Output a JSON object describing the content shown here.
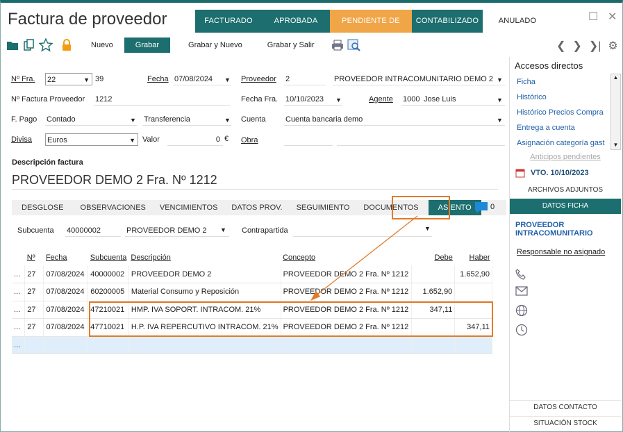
{
  "window": {
    "title": "Factura de proveedor"
  },
  "status_steps": [
    {
      "label": "FACTURADO",
      "width": 96
    },
    {
      "label": "APROBADA",
      "width": 98
    },
    {
      "label": "PENDIENTE DE PAGO",
      "width": 118
    },
    {
      "label": "CONTABILIZADO",
      "width": 102
    },
    {
      "label": "ANULADO",
      "width": 100
    }
  ],
  "toolbar": {
    "nuevo": "Nuevo",
    "grabar": "Grabar",
    "grabar_nuevo": "Grabar y Nuevo",
    "grabar_salir": "Grabar y Salir"
  },
  "form": {
    "nfra_label": "Nº Fra.",
    "nfra_serie": "22",
    "nfra_num": "39",
    "fecha_label": "Fecha",
    "fecha": "07/08/2024",
    "proveedor_label": "Proveedor",
    "proveedor_code": "2",
    "proveedor_name": "PROVEEDOR INTRACOMUNITARIO DEMO 2",
    "nfact_prov_label": "Nº Factura Proveedor",
    "nfact_prov": "1212",
    "fechafra_label": "Fecha Fra.",
    "fechafra": "10/10/2023",
    "agente_label": "Agente",
    "agente_code": "1000",
    "agente_name": "Jose Luis",
    "fpago_label": "F. Pago",
    "fpago": "Contado",
    "fpago2": "Transferencia",
    "cuenta_label": "Cuenta",
    "cuenta": "Cuenta bancaria demo",
    "divisa_label": "Divisa",
    "divisa": "Euros",
    "valor_label": "Valor",
    "valor": "0",
    "valor_unit": "€",
    "obra_label": "Obra"
  },
  "descripcion": {
    "label": "Descripción factura",
    "value": "PROVEEDOR DEMO 2 Fra. Nº 1212"
  },
  "tabs": [
    "DESGLOSE",
    "OBSERVACIONES",
    "VENCIMIENTOS",
    "DATOS PROV.",
    "SEGUIMIENTO",
    "DOCUMENTOS",
    "ASIENTO"
  ],
  "comments_count": "0",
  "asiento": {
    "subcuenta_label": "Subcuenta",
    "subcuenta": "40000002",
    "subcuenta_name": "PROVEEDOR DEMO 2",
    "contrapartida_label": "Contrapartida",
    "headers": [
      "Nº",
      "Fecha",
      "Subcuenta",
      "Descripción",
      "Concepto",
      "Debe",
      "Haber"
    ],
    "rows": [
      {
        "n": "27",
        "fecha": "07/08/2024",
        "sub": "40000002",
        "desc": "PROVEEDOR DEMO 2",
        "concepto": "PROVEEDOR DEMO 2 Fra. Nº 1212",
        "debe": "",
        "haber": "1.652,90"
      },
      {
        "n": "27",
        "fecha": "07/08/2024",
        "sub": "60200005",
        "desc": "Material Consumo y Reposición",
        "concepto": "PROVEEDOR DEMO 2 Fra. Nº 1212",
        "debe": "1.652,90",
        "haber": ""
      },
      {
        "n": "27",
        "fecha": "07/08/2024",
        "sub": "47210021",
        "desc": "HMP. IVA SOPORT. INTRACOM. 21%",
        "concepto": "PROVEEDOR DEMO 2 Fra. Nº 1212",
        "debe": "347,11",
        "haber": ""
      },
      {
        "n": "27",
        "fecha": "07/08/2024",
        "sub": "47710021",
        "desc": "H.P. IVA REPERCUTIVO INTRACOM. 21%",
        "concepto": "PROVEEDOR DEMO 2 Fra. Nº 1212",
        "debe": "",
        "haber": "347,11"
      }
    ],
    "row_menu": "..."
  },
  "sidebar": {
    "title": "Accesos directos",
    "links": [
      "Ficha",
      "Histórico",
      "Histórico Precios Compra",
      "Entrega a cuenta",
      "Asignación categoría gast"
    ],
    "anticipos": "Anticipos pendientes",
    "vto": "VTO. 10/10/2023",
    "archivos": "ARCHIVOS ADJUNTOS",
    "datos_ficha": "DATOS FICHA",
    "prov_name": "PROVEEDOR INTRACOMUNITARIO",
    "responsable": "Responsable no asignado",
    "datos_contacto": "DATOS CONTACTO",
    "situacion_stock": "SITUACIÓN STOCK"
  },
  "colors": {
    "accent": "#1d6e6e",
    "pending": "#f0a547",
    "highlight": "#e07b2a",
    "link": "#1f5fa8"
  }
}
